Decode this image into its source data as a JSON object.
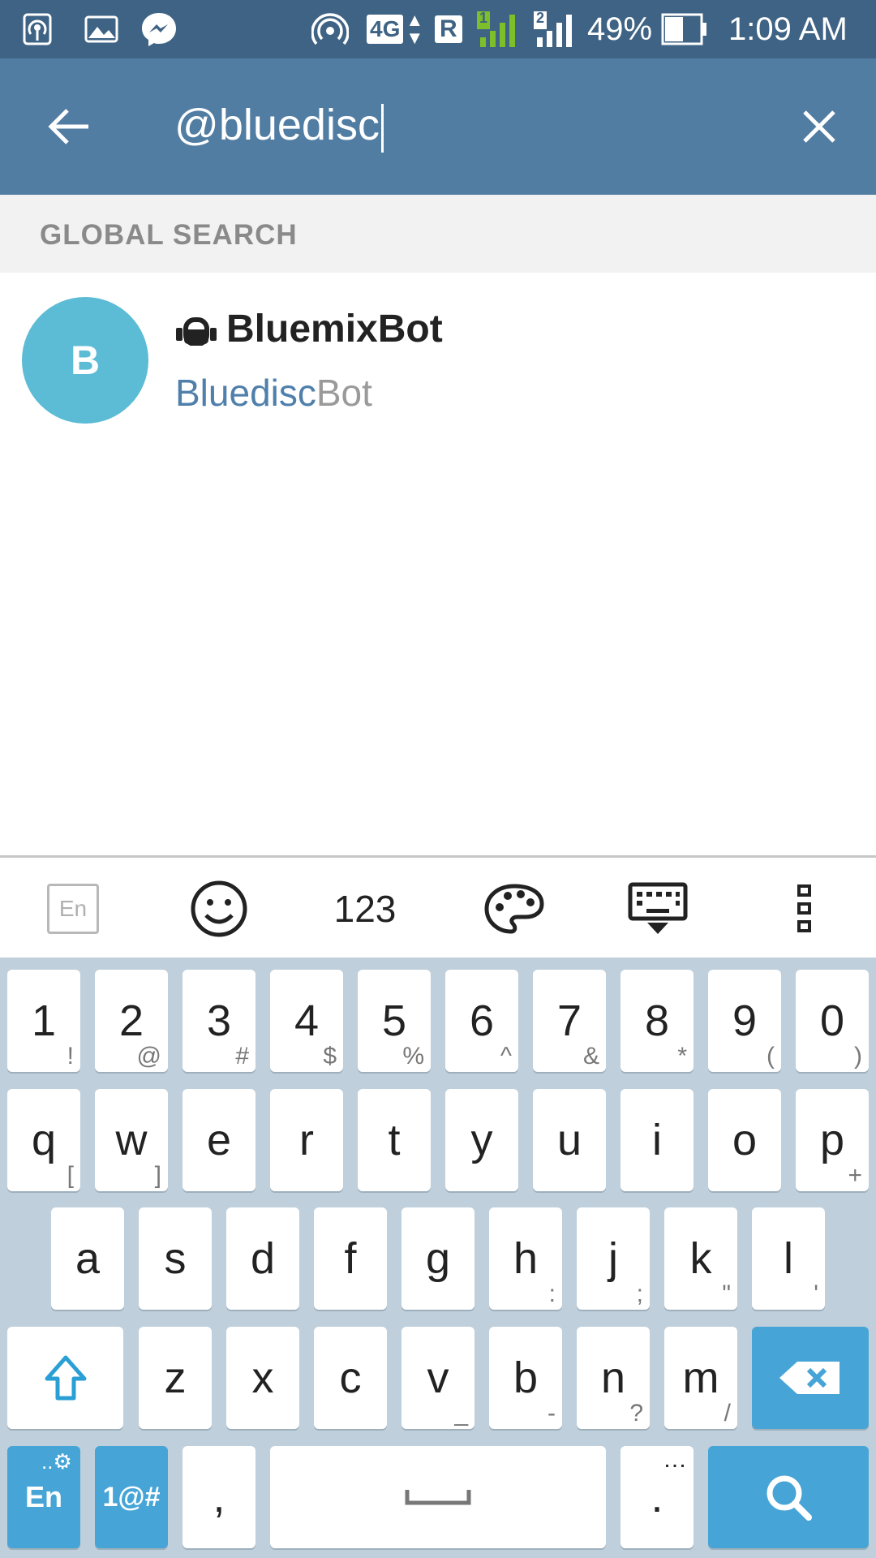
{
  "status_bar": {
    "battery": "49%",
    "time": "1:09 AM",
    "network_type": "4G",
    "roaming": "R",
    "sim1": "1",
    "sim2": "2",
    "icons": [
      "hotspot-icon",
      "gallery-icon",
      "messenger-icon",
      "wireless-icon",
      "signal-icon",
      "battery-icon"
    ]
  },
  "search": {
    "query": "@bluedisc"
  },
  "section": {
    "title": "GLOBAL SEARCH"
  },
  "result": {
    "avatar_letter": "B",
    "name": "BluemixBot",
    "username_match": "Bluedisc",
    "username_rest": "Bot",
    "avatar_color": "#5cbbd5"
  },
  "keyboard_toolbar": {
    "language_label": "En",
    "numbers_label": "123"
  },
  "keyboard": {
    "row_numbers": [
      {
        "main": "1",
        "sub": "!"
      },
      {
        "main": "2",
        "sub": "@"
      },
      {
        "main": "3",
        "sub": "#"
      },
      {
        "main": "4",
        "sub": "$"
      },
      {
        "main": "5",
        "sub": "%"
      },
      {
        "main": "6",
        "sub": "^"
      },
      {
        "main": "7",
        "sub": "&"
      },
      {
        "main": "8",
        "sub": "*"
      },
      {
        "main": "9",
        "sub": "("
      },
      {
        "main": "0",
        "sub": ")"
      }
    ],
    "row_top": [
      {
        "main": "q",
        "sub": "["
      },
      {
        "main": "w",
        "sub": "]"
      },
      {
        "main": "e",
        "sub": ""
      },
      {
        "main": "r",
        "sub": ""
      },
      {
        "main": "t",
        "sub": ""
      },
      {
        "main": "y",
        "sub": ""
      },
      {
        "main": "u",
        "sub": ""
      },
      {
        "main": "i",
        "sub": ""
      },
      {
        "main": "o",
        "sub": ""
      },
      {
        "main": "p",
        "sub": "+"
      }
    ],
    "row_mid": [
      {
        "main": "a",
        "sub": ""
      },
      {
        "main": "s",
        "sub": ""
      },
      {
        "main": "d",
        "sub": ""
      },
      {
        "main": "f",
        "sub": ""
      },
      {
        "main": "g",
        "sub": ""
      },
      {
        "main": "h",
        "sub": ":"
      },
      {
        "main": "j",
        "sub": ";"
      },
      {
        "main": "k",
        "sub": "\""
      },
      {
        "main": "l",
        "sub": "'"
      }
    ],
    "row_bottom": [
      {
        "main": "z",
        "sub": ""
      },
      {
        "main": "x",
        "sub": ""
      },
      {
        "main": "c",
        "sub": ""
      },
      {
        "main": "v",
        "sub": "_"
      },
      {
        "main": "b",
        "sub": "-"
      },
      {
        "main": "n",
        "sub": "?"
      },
      {
        "main": "m",
        "sub": "/"
      }
    ],
    "lang_key": "En",
    "symbols_key": "1@#",
    "comma_key": ",",
    "period_key": ".",
    "period_sub": "…",
    "accent_color": "#46a5d6"
  },
  "colors": {
    "status_bar": "#3f6384",
    "app_bar": "#527da3",
    "username_highlight": "#4f7fab"
  }
}
